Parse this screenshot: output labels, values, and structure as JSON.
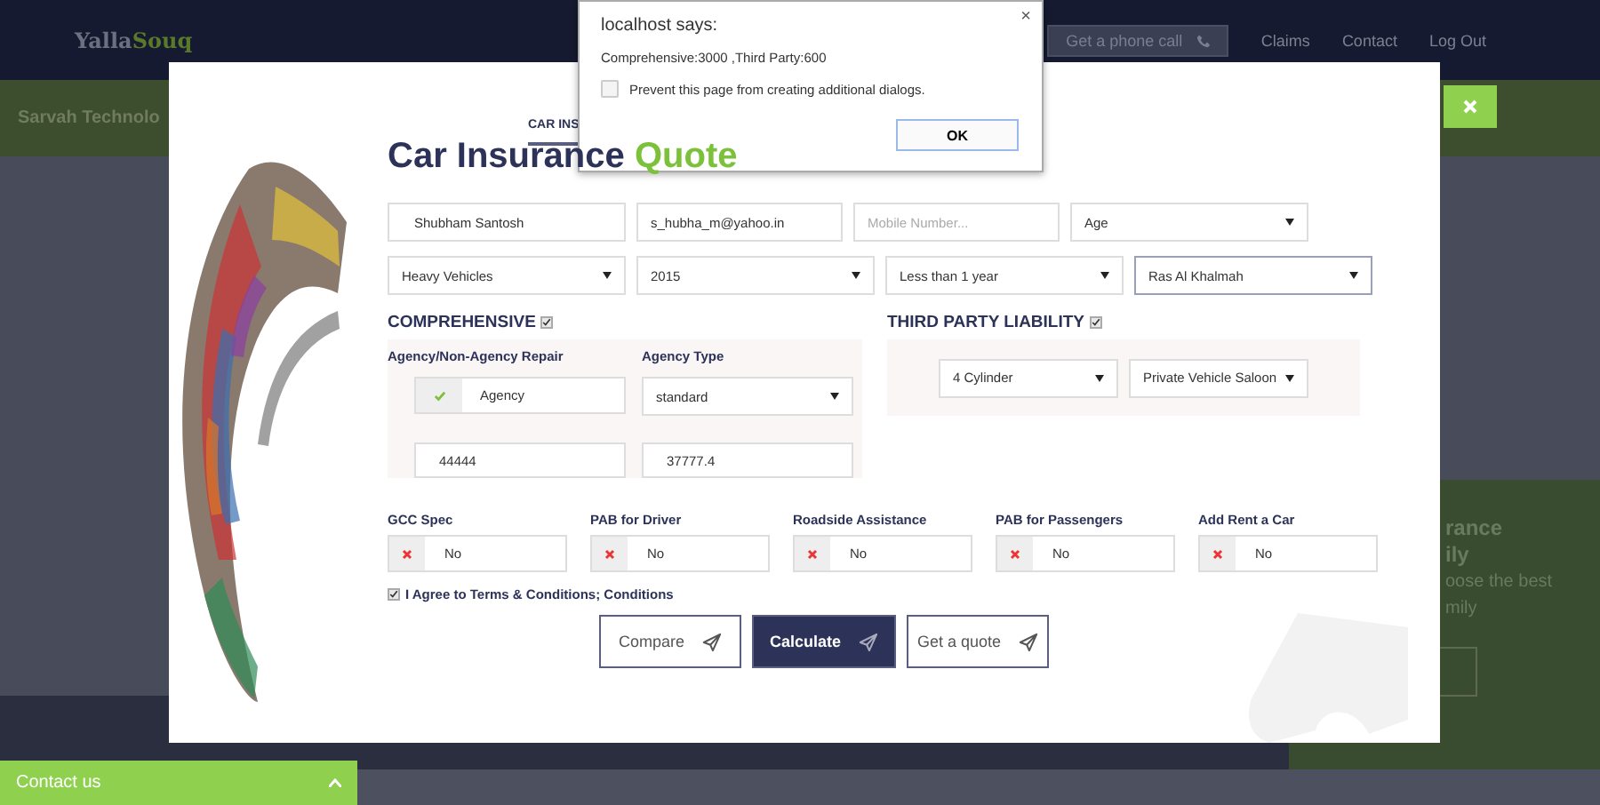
{
  "header": {
    "logo_first": "Yalla",
    "logo_second": "Souq",
    "phone_button": "Get a phone call",
    "nav": [
      "Claims",
      "Contact",
      "Log Out"
    ]
  },
  "banner": {
    "text": "Sarvah Technolo"
  },
  "side_panel": {
    "heading_lines": [
      "rance",
      "ily"
    ],
    "body_lines": [
      "oose the best",
      "mily"
    ]
  },
  "modal": {
    "tab": {
      "label": "CAR INS",
      "selected": true
    },
    "title": "Car Insurance",
    "title_accent": "Quote",
    "row_1": [
      {
        "kind": "input",
        "value": "Shubham Santosh"
      },
      {
        "kind": "input",
        "value": "s_hubha_m@yahoo.in"
      },
      {
        "kind": "input",
        "placeholder": "Mobile Number..."
      },
      {
        "kind": "select",
        "value": "Age",
        "focused": false
      }
    ],
    "row_2": [
      {
        "kind": "select",
        "value": "Heavy Vehicles",
        "focused": false
      },
      {
        "kind": "select",
        "value": "2015",
        "focused": false
      },
      {
        "kind": "select",
        "value": "Less than 1 year",
        "focused": false
      },
      {
        "kind": "select",
        "value": "Ras Al Khalmah",
        "focused": true
      }
    ],
    "comprehensive": {
      "label": "COMPREHENSIVE",
      "checked": true,
      "repair_label": "Agency/Non-Agency Repair",
      "repair": {
        "value": "Agency",
        "on": true
      },
      "agency_type_label": "Agency Type",
      "agency_type": "standard",
      "amounts": [
        "44444",
        "37777.4"
      ]
    },
    "third_party": {
      "label": "THIRD PARTY LIABILITY",
      "checked": true,
      "selects": [
        "4 Cylinder",
        "Private Vehicle Saloon"
      ]
    },
    "options": [
      {
        "label": "GCC Spec",
        "value": "No",
        "on": false
      },
      {
        "label": "PAB for Driver",
        "value": "No",
        "on": false
      },
      {
        "label": "Roadside Assistance",
        "value": "No",
        "on": false
      },
      {
        "label": "PAB for Passengers",
        "value": "No",
        "on": false
      },
      {
        "label": "Add Rent a Car",
        "value": "No",
        "on": false
      }
    ],
    "terms": {
      "label": "I Agree to Terms & Conditions; Conditions",
      "checked": true
    },
    "buttons": [
      {
        "label": "Compare",
        "primary": false
      },
      {
        "label": "Calculate",
        "primary": true
      },
      {
        "label": "Get a quote",
        "primary": false
      }
    ]
  },
  "alert": {
    "title": "localhost says:",
    "close": "×",
    "message": "Comprehensive:3000 ,Third Party:600",
    "prevent": {
      "label": "Prevent this page from creating additional dialogs.",
      "checked": false
    },
    "button": "OK"
  },
  "contact_bar": {
    "label": "Contact us"
  }
}
